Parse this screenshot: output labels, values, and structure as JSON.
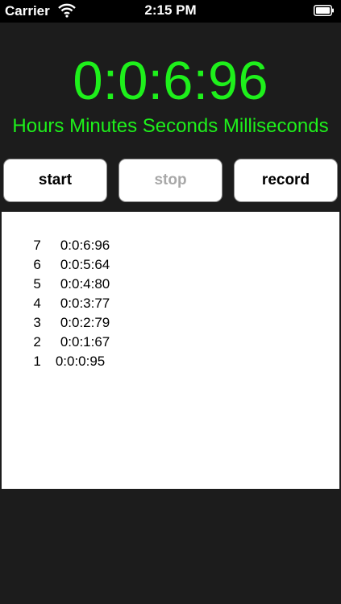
{
  "status_bar": {
    "carrier": "Carrier",
    "time": "2:15 PM",
    "wifi_icon": "wifi-icon",
    "battery_icon": "battery-icon"
  },
  "timer": {
    "display": "0:0:6:96",
    "units_label": "Hours Minutes Seconds Milliseconds",
    "color": "#1ef01b"
  },
  "buttons": {
    "start_label": "start",
    "stop_label": "stop",
    "record_label": "record"
  },
  "laps": [
    {
      "num": "7",
      "time": "0:0:6:96"
    },
    {
      "num": "6",
      "time": "0:0:5:64"
    },
    {
      "num": "5",
      "time": "0:0:4:80"
    },
    {
      "num": "4",
      "time": "0:0:3:77"
    },
    {
      "num": "3",
      "time": "0:0:2:79"
    },
    {
      "num": "2",
      "time": "0:0:1:67"
    },
    {
      "num": "1",
      "time": "0:0:0:95"
    }
  ]
}
